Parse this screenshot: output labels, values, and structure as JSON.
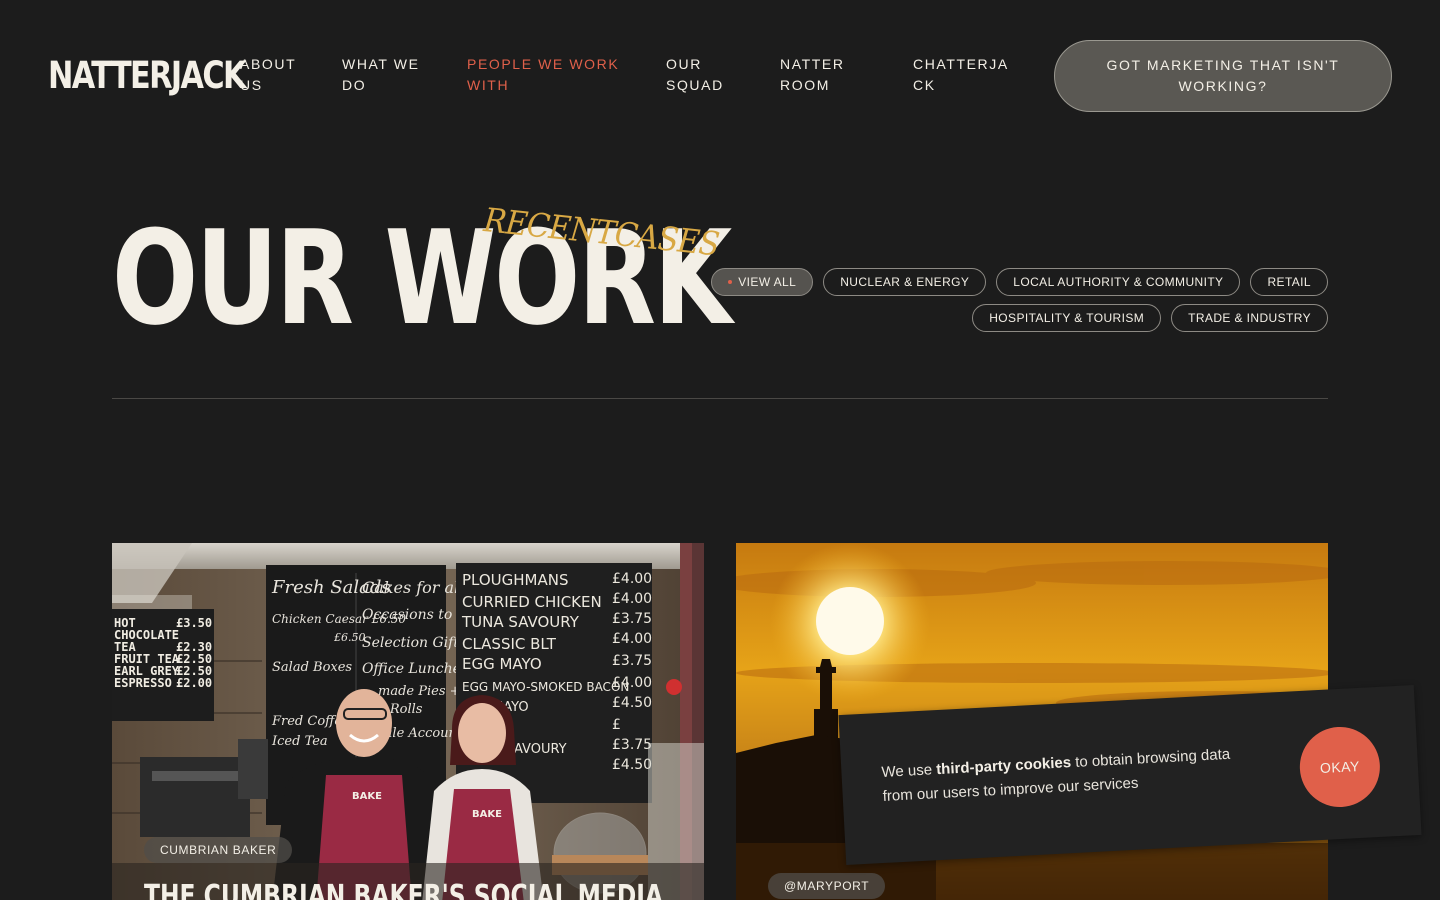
{
  "header": {
    "logo": "NATTERJACK",
    "nav": [
      {
        "line1": "ABOUT",
        "line2": "US"
      },
      {
        "line1": "WHAT WE",
        "line2": "DO"
      },
      {
        "line1": "PEOPLE WE WORK",
        "line2": "WITH"
      },
      {
        "line1": "OUR",
        "line2": "SQUAD"
      },
      {
        "line1": "NATTER",
        "line2": "ROOM"
      },
      {
        "line1": "CHATTERJA",
        "line2": "CK"
      }
    ],
    "cta": {
      "line1": "GOT MARKETING THAT ISN'T",
      "line2": "WORKING?"
    }
  },
  "hero": {
    "title": "OUR WORK",
    "script": "RECENTCASES"
  },
  "filters": {
    "row1": [
      "VIEW ALL",
      "NUCLEAR & ENERGY",
      "LOCAL AUTHORITY & COMMUNITY",
      "RETAIL"
    ],
    "row2": [
      "HOSPITALITY & TOURISM",
      "TRADE & INDUSTRY"
    ]
  },
  "cards": [
    {
      "tag": "CUMBRIAN BAKER",
      "title": "THE CUMBRIAN BAKER'S SOCIAL MEDIA"
    },
    {
      "tag": "@MARYPORT",
      "title": ""
    }
  ],
  "bakery_board": {
    "left_menu": [
      "HOT",
      "CHOCOLATE",
      "TEA",
      "FRUIT TEA",
      "EARL GREY",
      "ESPRESSO"
    ],
    "left_prices": [
      "£3.50",
      "",
      "£2.30",
      "£2.50",
      "£2.50",
      "£2.00"
    ],
    "mid_col1": [
      "Fresh Salads",
      "Chicken Caesar £6.50",
      "£6.50",
      "Salad Boxes",
      "Fred Coffee",
      "Iced Tea"
    ],
    "mid_col2": [
      "Cakes for all",
      "Occasions to Order",
      "Selection Gift Boxes",
      "Office Lunches",
      "made Pies +",
      "e Rolls",
      "sale Accounts"
    ],
    "right_items": [
      "PLOUGHMANS",
      "CURRIED CHICKEN",
      "TUNA SAVOURY",
      "CLASSIC BLT",
      "EGG MAYO",
      "EGG MAYO-SMOKED BACON",
      "MAYO",
      "AVOURY"
    ],
    "right_prices": [
      "£4.00",
      "£4.00",
      "£3.75",
      "£4.00",
      "£3.75",
      "£4.00",
      "£4.50",
      "£",
      "£3.75",
      "£4.50"
    ],
    "apron_text": "BAKE"
  },
  "cookie": {
    "text_before": "We use ",
    "text_bold": "third-party cookies",
    "text_after": " to obtain browsing data from our users to improve our services",
    "button": "OKAY"
  },
  "colors": {
    "background": "#1c1c1c",
    "text": "#f3efe6",
    "accent": "#e0604a",
    "script": "#d8a844"
  }
}
